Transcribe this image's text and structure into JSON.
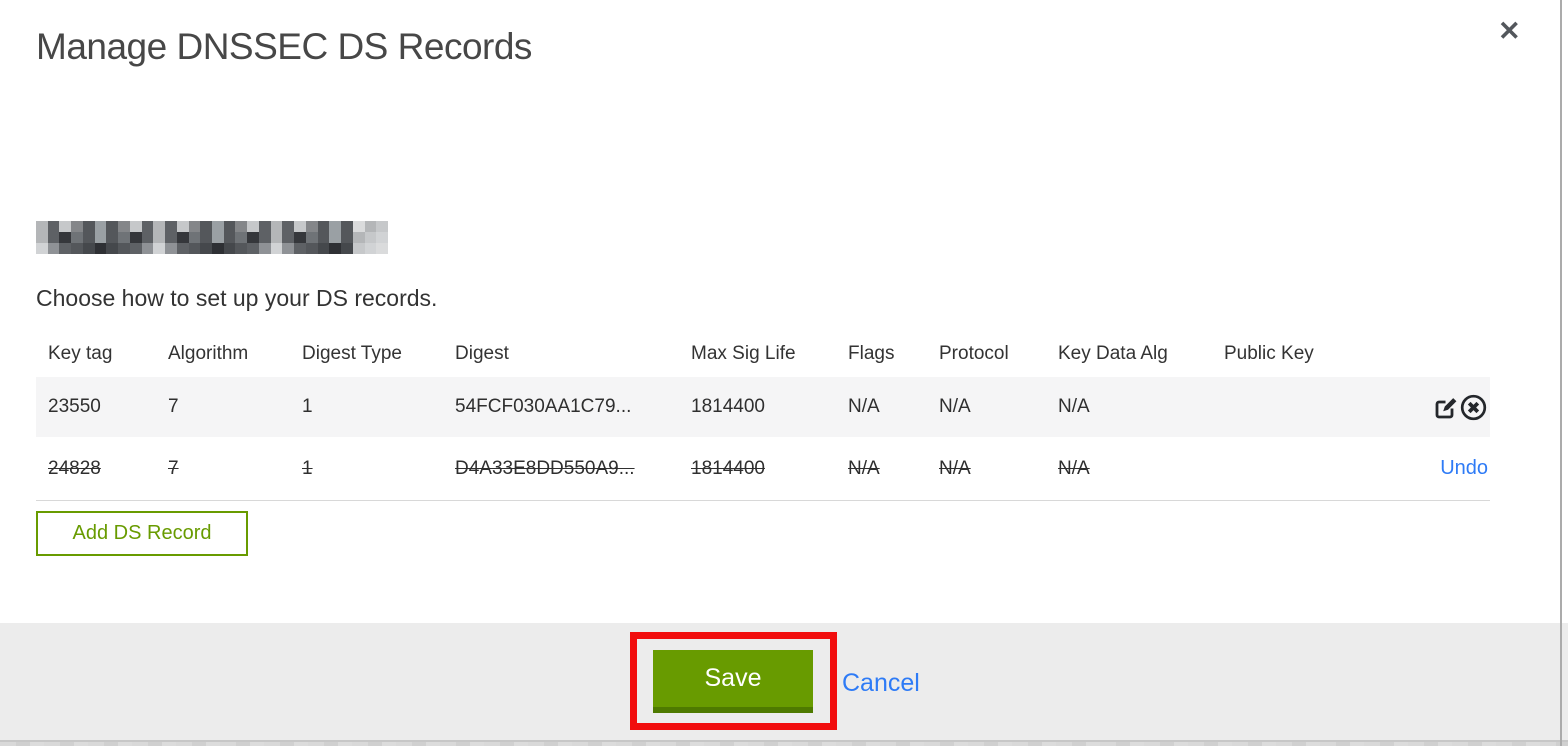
{
  "modal": {
    "title": "Manage DNSSEC DS Records",
    "close_icon": "✕",
    "instruction": "Choose how to set up your DS records.",
    "domain_redacted": true
  },
  "table": {
    "headers": [
      "Key tag",
      "Algorithm",
      "Digest Type",
      "Digest",
      "Max Sig Life",
      "Flags",
      "Protocol",
      "Key Data Alg",
      "Public Key"
    ],
    "rows": [
      {
        "cells": [
          "23550",
          "7",
          "1",
          "54FCF030AA1C79...",
          "1814400",
          "N/A",
          "N/A",
          "N/A",
          ""
        ],
        "deleted": false,
        "actions": [
          "edit",
          "delete"
        ]
      },
      {
        "cells": [
          "24828",
          "7",
          "1",
          "D4A33E8DD550A9...",
          "1814400",
          "N/A",
          "N/A",
          "N/A",
          ""
        ],
        "deleted": true,
        "actions": [
          "undo"
        ]
      }
    ]
  },
  "actions": {
    "add_ds_record_label": "Add DS Record",
    "save_label": "Save",
    "cancel_label": "Cancel",
    "undo_label": "Undo"
  },
  "colors": {
    "accent_green": "#689b00",
    "accent_green_dark": "#4e7a00",
    "link_blue": "#2e7bf6",
    "annotation_red": "#f10d0d",
    "footer_gray": "#ececec",
    "row_highlight_gray": "#f5f5f6",
    "redacted_palette": [
      "#b4b6b8",
      "#54575b",
      "#2e3034",
      "#8f9296",
      "#c6c8ca",
      "#3e4145",
      "#6f7377",
      "#9aa0a4",
      "#5e6165",
      "#d1d3d5",
      "#45484c",
      "#848689",
      "#dadbdc",
      "#35373b"
    ]
  }
}
